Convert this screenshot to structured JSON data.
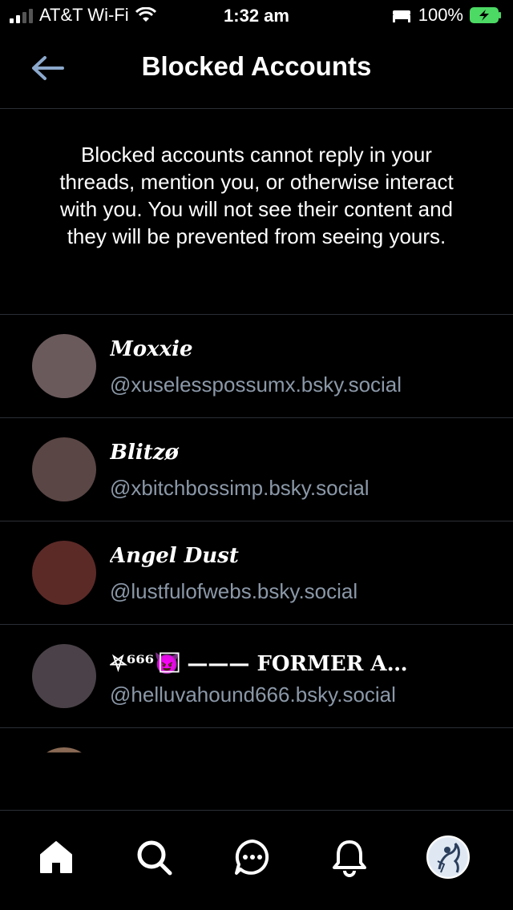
{
  "status_bar": {
    "carrier": "AT&T Wi-Fi",
    "time": "1:32 am",
    "battery_percent": "100%"
  },
  "header": {
    "title": "Blocked Accounts",
    "back_icon": "back-arrow-icon"
  },
  "description": "Blocked accounts cannot reply in your threads, mention you, or otherwise interact with you. You will not see their content and they will be prevented from seeing yours.",
  "blocked_accounts": [
    {
      "name": "Moxxie",
      "handle": "@xuselesspossumx.bsky.social",
      "avatar_color": "#6b5a5c"
    },
    {
      "name": "Blitzø",
      "handle": "@xbitchbossimp.bsky.social",
      "avatar_color": "#5a4645"
    },
    {
      "name": "Angel Dust",
      "handle": "@lustfulofwebs.bsky.social",
      "avatar_color": "#5b2a27"
    },
    {
      "name": "⛧⁶⁶⁶😈⃞ ——— FORMER A…",
      "handle": "@helluvahound666.bsky.social",
      "avatar_color": "#4a4248"
    }
  ],
  "bottom_nav": [
    {
      "name": "home",
      "icon": "home-icon"
    },
    {
      "name": "search",
      "icon": "search-icon"
    },
    {
      "name": "chat",
      "icon": "chat-icon"
    },
    {
      "name": "notifications",
      "icon": "bell-icon"
    },
    {
      "name": "profile",
      "icon": "profile-avatar"
    }
  ],
  "colors": {
    "background": "#000000",
    "divider": "#2a2f36",
    "handle": "#8b98a8",
    "back_arrow": "#8ba8cc",
    "battery_green": "#4cd964"
  }
}
